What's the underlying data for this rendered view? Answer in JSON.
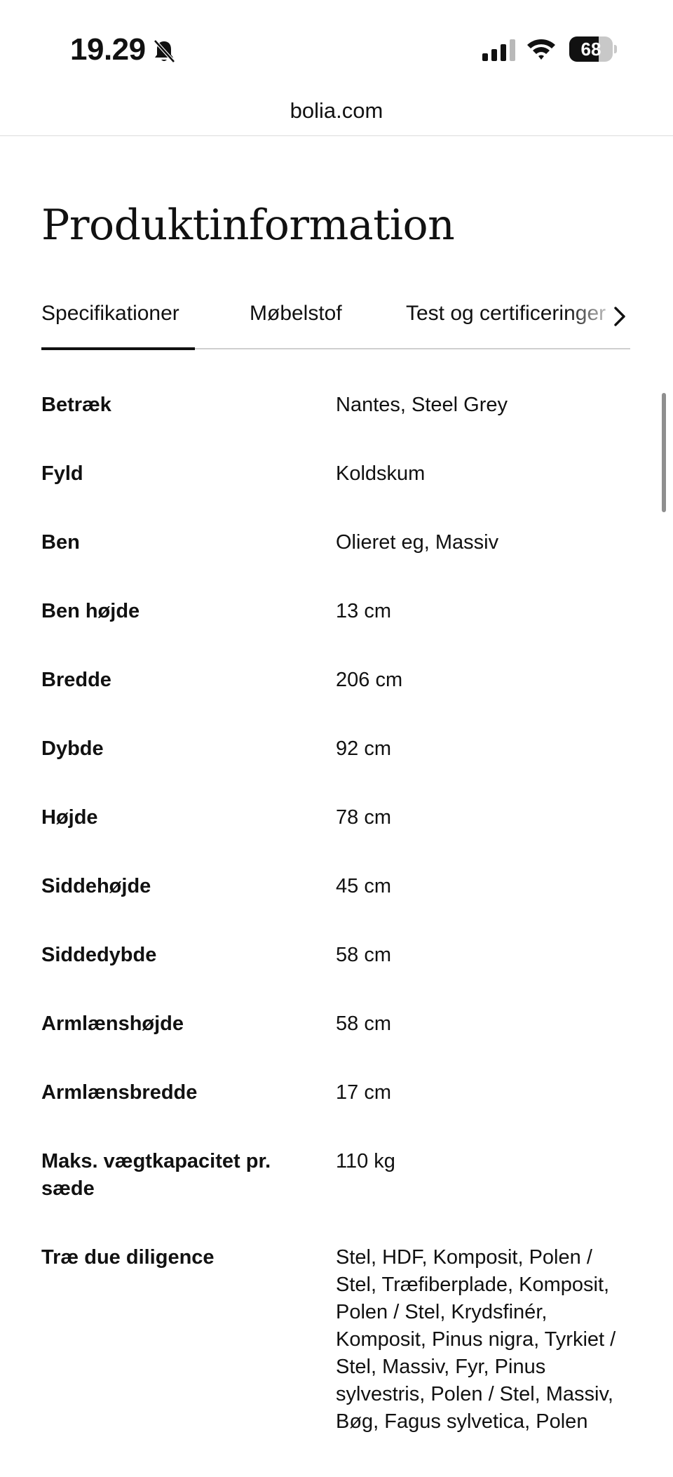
{
  "status_bar": {
    "time": "19.29",
    "battery_level": "68",
    "battery_fraction": 0.68
  },
  "browser": {
    "url": "bolia.com"
  },
  "page": {
    "title": "Produktinformation",
    "tabs": [
      {
        "label": "Specifikationer",
        "active": true
      },
      {
        "label": "Møbelstof",
        "active": false
      },
      {
        "label": "Test og certificeringer",
        "active": false
      }
    ],
    "specs": [
      {
        "label": "Betræk",
        "value": "Nantes, Steel Grey"
      },
      {
        "label": "Fyld",
        "value": "Koldskum"
      },
      {
        "label": "Ben",
        "value": "Olieret eg, Massiv"
      },
      {
        "label": "Ben højde",
        "value": "13 cm"
      },
      {
        "label": "Bredde",
        "value": "206 cm"
      },
      {
        "label": "Dybde",
        "value": "92 cm"
      },
      {
        "label": "Højde",
        "value": "78 cm"
      },
      {
        "label": "Siddehøjde",
        "value": "45 cm"
      },
      {
        "label": "Siddedybde",
        "value": "58 cm"
      },
      {
        "label": "Armlænshøjde",
        "value": "58 cm"
      },
      {
        "label": "Armlænsbredde",
        "value": "17 cm"
      },
      {
        "label": "Maks. vægtkapacitet pr. sæde",
        "value": "110 kg"
      },
      {
        "label": "Træ due diligence",
        "value": "Stel, HDF, Komposit, Polen / Stel, Træfiberplade, Komposit, Polen / Stel, Krydsfinér, Komposit, Pinus nigra, Tyrkiet / Stel, Massiv, Fyr, Pinus sylvestris, Polen / Stel, Massiv, Bøg, Fagus sylvetica, Polen"
      }
    ]
  },
  "icons": {
    "bell": "bell-muted-icon",
    "signal": "cellular-signal-icon",
    "wifi": "wifi-icon",
    "tabs_scroll": "chevron-right-icon"
  }
}
